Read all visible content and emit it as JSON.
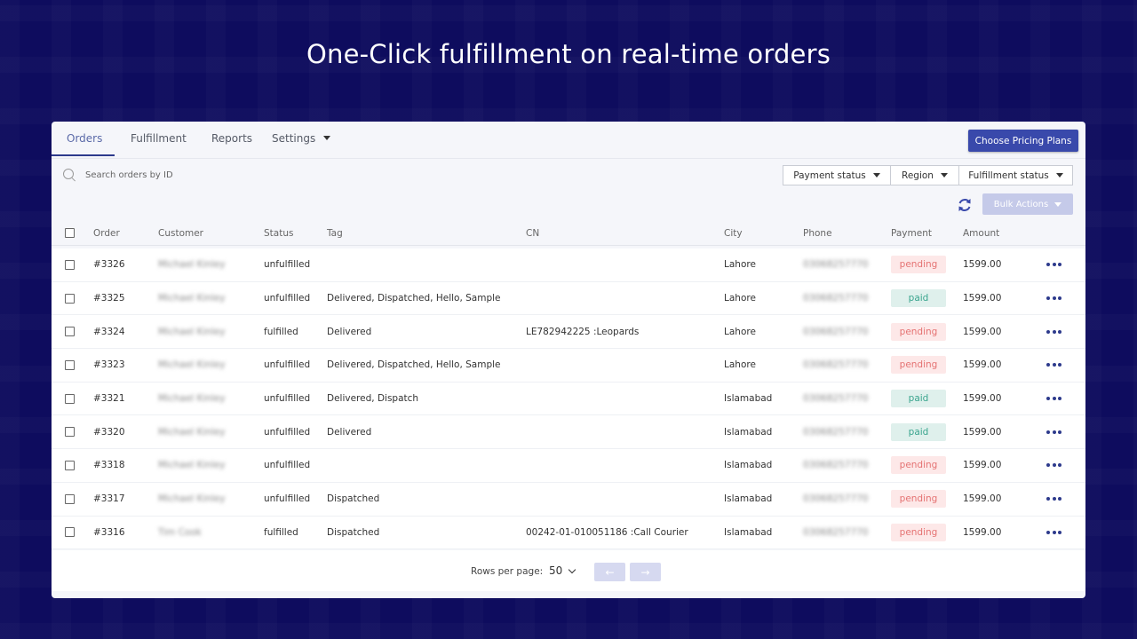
{
  "headline": "One-Click fulfillment on real-time orders",
  "colors": {
    "background": "#0e0c5e",
    "accent": "#3949ab",
    "pending_bg": "#fde8e8",
    "pending_text": "#e57373",
    "paid_bg": "#dff0ec",
    "paid_text": "#3aa58e"
  },
  "tabs": [
    {
      "label": "Orders",
      "active": true
    },
    {
      "label": "Fulfillment",
      "active": false
    },
    {
      "label": "Reports",
      "active": false
    },
    {
      "label": "Settings",
      "active": false
    }
  ],
  "pricing_button": "Choose Pricing Plans",
  "search": {
    "placeholder": "Search orders by ID",
    "value": ""
  },
  "filters": [
    "Payment status",
    "Region",
    "Fulfillment status"
  ],
  "bulk_actions": "Bulk Actions",
  "columns": [
    "Order",
    "Customer",
    "Status",
    "Tag",
    "CN",
    "City",
    "Phone",
    "Payment",
    "Amount"
  ],
  "rows": [
    {
      "order": "#3326",
      "customer": "Michael Kinley",
      "status": "unfulfilled",
      "tag": "",
      "cn": "",
      "city": "Lahore",
      "phone": "03068257770",
      "payment": "pending",
      "amount": "1599.00"
    },
    {
      "order": "#3325",
      "customer": "Michael Kinley",
      "status": "unfulfilled",
      "tag": "Delivered, Dispatched, Hello, Sample",
      "cn": "",
      "city": "Lahore",
      "phone": "03068257770",
      "payment": "paid",
      "amount": "1599.00"
    },
    {
      "order": "#3324",
      "customer": "Michael Kinley",
      "status": "fulfilled",
      "tag": "Delivered",
      "cn": "LE782942225 :Leopards",
      "city": "Lahore",
      "phone": "03068257770",
      "payment": "pending",
      "amount": "1599.00"
    },
    {
      "order": "#3323",
      "customer": "Michael Kinley",
      "status": "unfulfilled",
      "tag": "Delivered, Dispatched, Hello, Sample",
      "cn": "",
      "city": "Lahore",
      "phone": "03068257770",
      "payment": "pending",
      "amount": "1599.00"
    },
    {
      "order": "#3321",
      "customer": "Michael Kinley",
      "status": "unfulfilled",
      "tag": "Delivered, Dispatch",
      "cn": "",
      "city": "Islamabad",
      "phone": "03068257770",
      "payment": "paid",
      "amount": "1599.00"
    },
    {
      "order": "#3320",
      "customer": "Michael Kinley",
      "status": "unfulfilled",
      "tag": "Delivered",
      "cn": "",
      "city": "Islamabad",
      "phone": "03068257770",
      "payment": "paid",
      "amount": "1599.00"
    },
    {
      "order": "#3318",
      "customer": "Michael Kinley",
      "status": "unfulfilled",
      "tag": "",
      "cn": "",
      "city": "Islamabad",
      "phone": "03068257770",
      "payment": "pending",
      "amount": "1599.00"
    },
    {
      "order": "#3317",
      "customer": "Michael Kinley",
      "status": "unfulfilled",
      "tag": "Dispatched",
      "cn": "",
      "city": "Islamabad",
      "phone": "03068257770",
      "payment": "pending",
      "amount": "1599.00"
    },
    {
      "order": "#3316",
      "customer": "Tim Cook",
      "status": "fulfilled",
      "tag": "Dispatched",
      "cn": "00242-01-010051186 :Call Courier",
      "city": "Islamabad",
      "phone": "03068257770",
      "payment": "pending",
      "amount": "1599.00"
    }
  ],
  "pagination": {
    "rows_per_page_label": "Rows per page:",
    "rows_per_page": "50",
    "prev_icon": "arrow-left",
    "next_icon": "arrow-right"
  }
}
